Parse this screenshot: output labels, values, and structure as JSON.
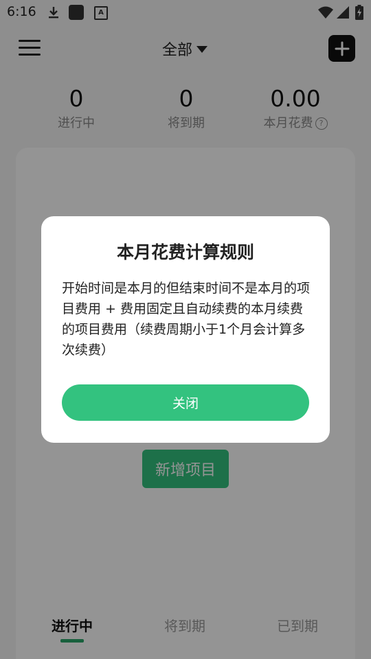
{
  "status_bar": {
    "time": "6:16",
    "icons": [
      "download-icon",
      "app-icon",
      "font-icon",
      "wifi-icon",
      "signal-icon",
      "battery-charging-icon"
    ],
    "a_glyph": "A"
  },
  "header": {
    "filter_label": "全部",
    "menu_icon": "menu-icon",
    "add_icon": "plus-icon"
  },
  "stats": [
    {
      "value": "0",
      "label": "进行中"
    },
    {
      "value": "0",
      "label": "将到期"
    },
    {
      "value": "0.00",
      "label": "本月花费"
    }
  ],
  "main": {
    "new_project_label": "新增项目",
    "tabs": [
      {
        "label": "进行中",
        "active": true
      },
      {
        "label": "将到期",
        "active": false
      },
      {
        "label": "已到期",
        "active": false
      }
    ]
  },
  "dialog": {
    "title": "本月花费计算规则",
    "body": "开始时间是本月的但结束时间不是本月的项目费用 + 费用固定且自动续费的本月续费的项目费用（续费周期小于1个月会计算多次续费）",
    "close_label": "关闭"
  },
  "colors": {
    "accent": "#33c27f",
    "tab_indicator": "#2aa56a"
  }
}
